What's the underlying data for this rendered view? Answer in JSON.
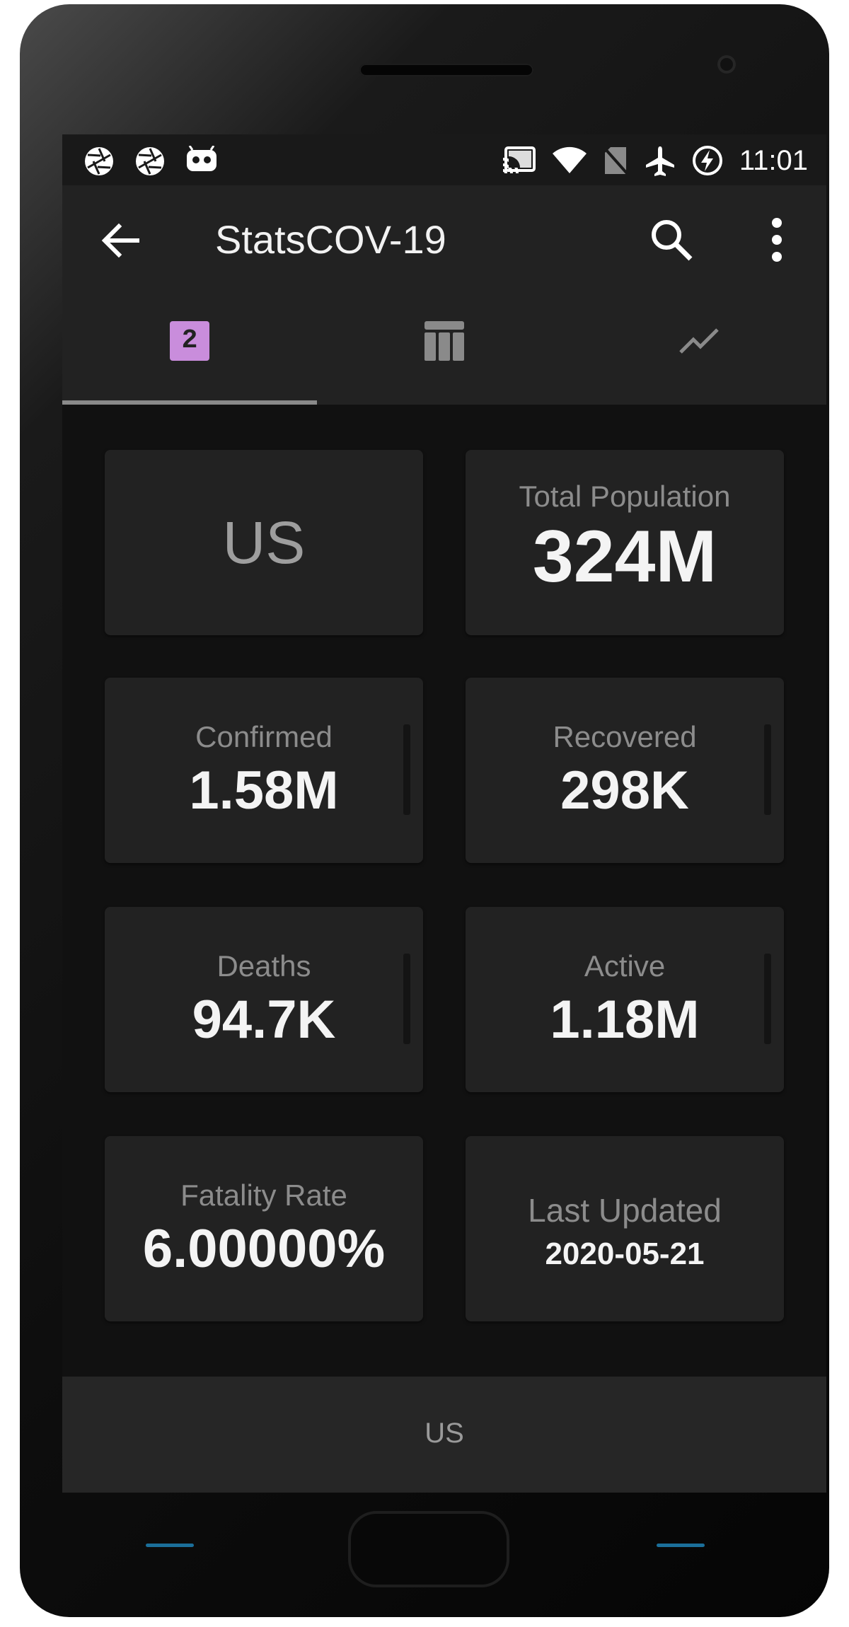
{
  "status_bar": {
    "time": "11:01",
    "left_icons": [
      "aperture-icon",
      "aperture-icon",
      "android-bot-icon"
    ],
    "right_icons": [
      "cast-icon",
      "wifi-icon",
      "no-sim-icon",
      "airplane-icon",
      "battery-saver-icon"
    ]
  },
  "app_bar": {
    "title": "StatsCOV-19",
    "back_icon": "arrow-left-icon",
    "search_icon": "search-icon",
    "menu_icon": "more-vert-icon"
  },
  "tabs": [
    {
      "name": "numeric",
      "icon": "numeric-badge-icon",
      "badge": "2",
      "selected": true
    },
    {
      "name": "table",
      "icon": "table-icon",
      "selected": false
    },
    {
      "name": "chart",
      "icon": "trending-up-icon",
      "selected": false
    }
  ],
  "cards": {
    "country": "US",
    "population": {
      "label": "Total Population",
      "value": "324M"
    },
    "confirmed": {
      "label": "Confirmed",
      "value": "1.58M"
    },
    "recovered": {
      "label": "Recovered",
      "value": "298K"
    },
    "deaths": {
      "label": "Deaths",
      "value": "94.7K"
    },
    "active": {
      "label": "Active",
      "value": "1.18M"
    },
    "fatality": {
      "label": "Fatality Rate",
      "value": "6.00000%"
    },
    "updated": {
      "label": "Last Updated",
      "value": "2020-05-21"
    }
  },
  "footer": {
    "label": "US"
  },
  "colors": {
    "background": "#111111",
    "surface": "#222222",
    "accent_badge": "#c98ddc",
    "label_text": "#8c8c8c",
    "value_text": "#f4f4f4"
  }
}
